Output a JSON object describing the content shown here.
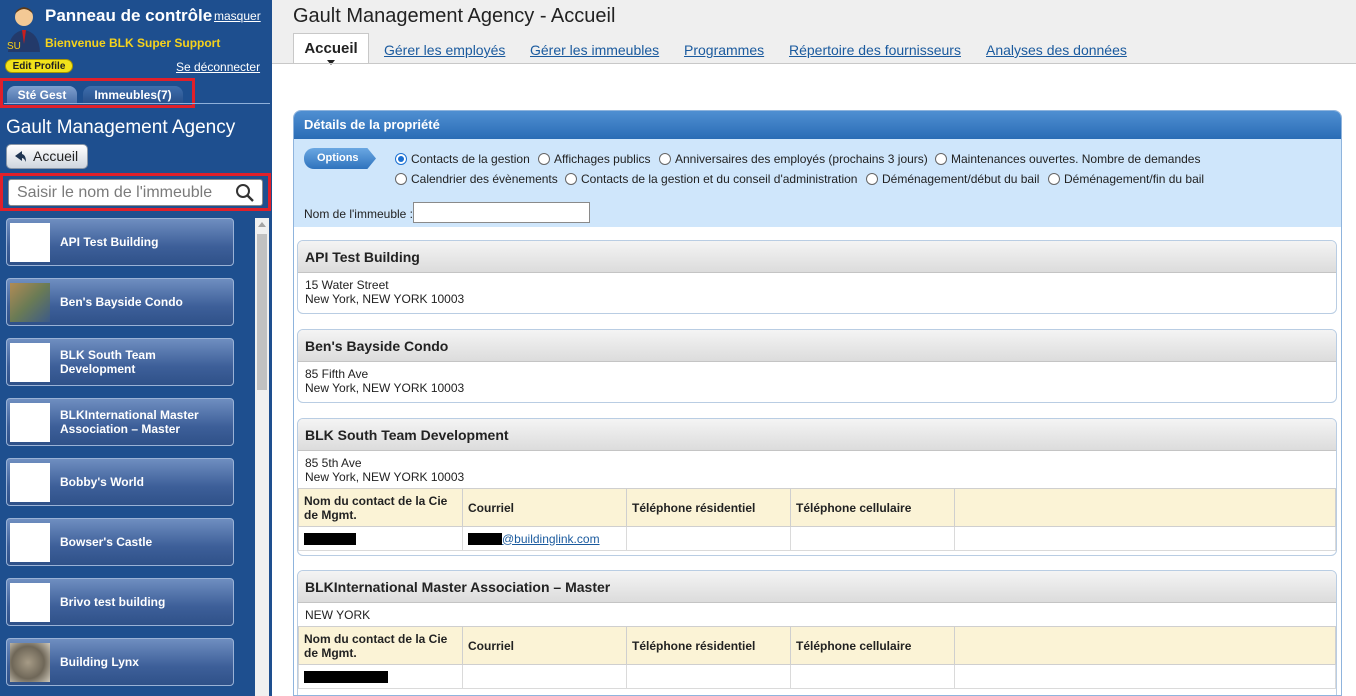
{
  "sidebar": {
    "title": "Panneau de contrôle",
    "hide_label": "masquer",
    "avatar_badge": "SU",
    "welcome": "Bienvenue BLK Super Support",
    "edit_profile": "Edit Profile",
    "logout": "Se déconnecter",
    "tabs": [
      {
        "label": "Sté Gest"
      },
      {
        "label": "Immeubles(7)"
      }
    ],
    "agency_name": "Gault Management Agency",
    "home_button": "Accueil",
    "search_placeholder": "Saisir le nom de l'immeuble",
    "buildings": [
      {
        "name": "API Test Building",
        "thumb": "blank"
      },
      {
        "name": "Ben's Bayside Condo",
        "thumb": "photo"
      },
      {
        "name": "BLK South Team Development",
        "thumb": "blank"
      },
      {
        "name": "BLKInternational Master Association – Master",
        "thumb": "blank"
      },
      {
        "name": "Bobby's World",
        "thumb": "blank"
      },
      {
        "name": "Bowser's Castle",
        "thumb": "blank"
      },
      {
        "name": "Brivo test building",
        "thumb": "blank"
      },
      {
        "name": "Building Lynx",
        "thumb": "cat"
      }
    ]
  },
  "main": {
    "page_title": "Gault Management Agency - Accueil",
    "tabs": [
      {
        "label": "Accueil"
      },
      {
        "label": "Gérer les employés"
      },
      {
        "label": "Gérer les immeubles"
      },
      {
        "label": "Programmes"
      },
      {
        "label": "Répertoire des fournisseurs"
      },
      {
        "label": "Analyses des données"
      }
    ],
    "panel_title": "Détails de la propriété",
    "options_button": "Options",
    "radio_options": [
      {
        "label": "Contacts de la gestion",
        "checked": true
      },
      {
        "label": "Affichages publics",
        "checked": false
      },
      {
        "label": "Anniversaires des employés (prochains 3 jours)",
        "checked": false
      },
      {
        "label": "Maintenances ouvertes. Nombre de demandes",
        "checked": false
      },
      {
        "label": "Calendrier des évènements",
        "checked": false
      },
      {
        "label": "Contacts de la gestion et du conseil d'administration",
        "checked": false
      },
      {
        "label": "Déménagement/début du bail",
        "checked": false
      },
      {
        "label": "Déménagement/fin du bail",
        "checked": false
      }
    ],
    "building_name_label": "Nom de l'immeuble :",
    "building_name_value": "",
    "contact_table_headers": [
      "Nom du contact de la Cie de Mgmt.",
      "Courriel",
      "Téléphone résidentiel",
      "Téléphone cellulaire",
      ""
    ],
    "properties": [
      {
        "name": "API Test Building",
        "address_line1": "15 Water Street",
        "address_line2": "New York, NEW YORK 10003"
      },
      {
        "name": "Ben's Bayside Condo",
        "address_line1": "85 Fifth Ave",
        "address_line2": "New York, NEW YORK 10003"
      },
      {
        "name": "BLK South Team Development",
        "address_line1": "85 5th Ave",
        "address_line2": "New York, NEW YORK 10003",
        "contact_email_domain": "@buildinglink.com"
      },
      {
        "name": "BLKInternational Master Association – Master",
        "address_line1": "NEW YORK"
      }
    ]
  }
}
